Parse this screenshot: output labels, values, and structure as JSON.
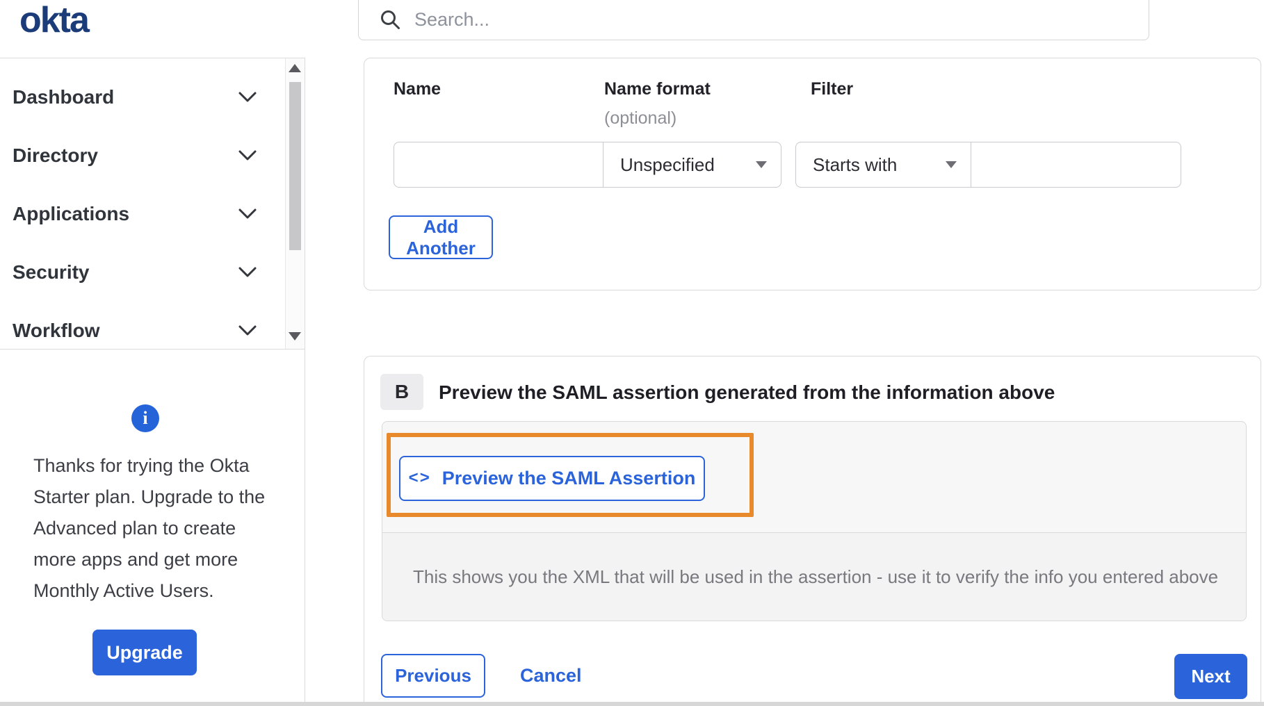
{
  "header": {
    "logo_text": "okta",
    "search_placeholder": "Search..."
  },
  "sidebar": {
    "items": [
      {
        "label": "Dashboard"
      },
      {
        "label": "Directory"
      },
      {
        "label": "Applications"
      },
      {
        "label": "Security"
      },
      {
        "label": "Workflow"
      }
    ],
    "trial_notice": {
      "info_icon": "i",
      "text": "Thanks for trying the Okta Starter plan. Upgrade to the Advanced plan to create more apps and get more Monthly Active Users.",
      "upgrade_label": "Upgrade"
    }
  },
  "attribute_form": {
    "name_label": "Name",
    "name_format_label": "Name format",
    "name_format_optional": "(optional)",
    "filter_label": "Filter",
    "name_value": "",
    "name_format_selected": "Unspecified",
    "filter_operator_selected": "Starts with",
    "filter_value": "",
    "add_another_label": "Add Another"
  },
  "section_b": {
    "badge": "B",
    "title": "Preview the SAML assertion generated from the information above",
    "code_icon": "<>",
    "preview_button_label": "Preview the SAML Assertion",
    "helper_text": "This shows you the XML that will be used in the assertion - use it to verify the info you entered above"
  },
  "footer": {
    "previous_label": "Previous",
    "cancel_label": "Cancel",
    "next_label": "Next"
  },
  "colors": {
    "primary_blue": "#2b63da",
    "logo_navy": "#1b3c78",
    "annotation_orange": "#e8892b",
    "panel_gray": "#f5f5f6"
  }
}
